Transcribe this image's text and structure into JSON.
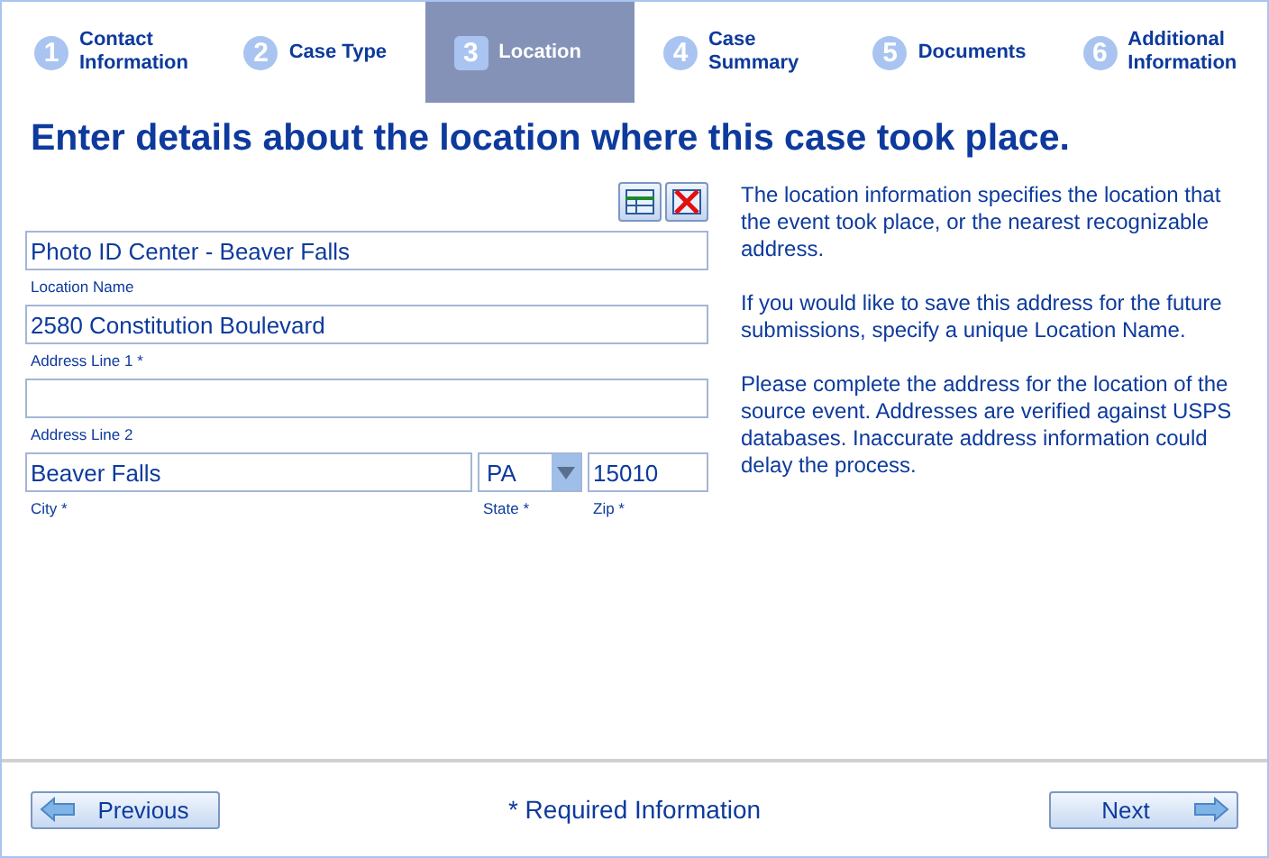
{
  "steps": [
    {
      "number": "1",
      "label": "Contact Information",
      "selected": false
    },
    {
      "number": "2",
      "label": "Case Type",
      "selected": false
    },
    {
      "number": "3",
      "label": "Location",
      "selected": true
    },
    {
      "number": "4",
      "label": "Case Summary",
      "selected": false
    },
    {
      "number": "5",
      "label": "Documents",
      "selected": false
    },
    {
      "number": "6",
      "label": "Additional Information",
      "selected": false
    }
  ],
  "heading": "Enter details about the location where this case took place.",
  "fields": [
    {
      "label": "Location Name",
      "value": "Photo ID Center - Beaver Falls"
    },
    {
      "label": "Address Line 1 *",
      "value": "2580 Constitution Boulevard"
    },
    {
      "label": "Address Line 2"
    }
  ],
  "city": {
    "label": "City *",
    "value": "Beaver Falls"
  },
  "state": {
    "label": "State *",
    "value": "PA"
  },
  "zip": {
    "label": "Zip *",
    "value": "15010"
  },
  "help": [
    "The location information specifies the location that the event took place, or the nearest recognizable address.",
    "If you would like to save this address for the future submissions, specify a unique Location Name.",
    "Please complete the address for the location of the source event. Addresses are verified against USPS databases. Inaccurate address information could delay the process."
  ],
  "footer": {
    "previous": "Previous",
    "required": "* Required Information",
    "next": "Next"
  }
}
